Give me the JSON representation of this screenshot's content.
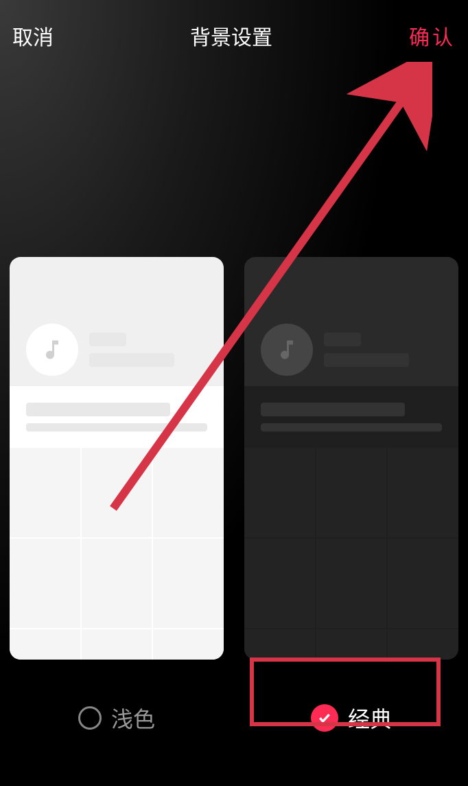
{
  "header": {
    "cancel_label": "取消",
    "title": "背景设置",
    "confirm_label": "确认"
  },
  "themes": {
    "light": {
      "label": "浅色",
      "selected": false
    },
    "classic": {
      "label": "经典",
      "selected": true
    }
  },
  "colors": {
    "accent": "#fe2c55",
    "highlight": "#d63447"
  }
}
